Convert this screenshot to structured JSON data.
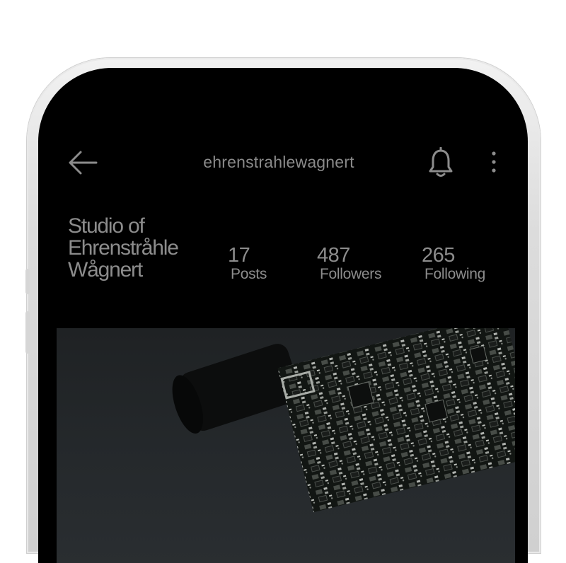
{
  "header": {
    "username": "ehrenstrahlewagnert"
  },
  "icons": {
    "back": "arrow-left-icon",
    "notifications": "bell-icon",
    "more": "more-vertical-icon"
  },
  "profile": {
    "display_name_lines": [
      "Studio of",
      "Ehrenstråhle",
      "Wågnert"
    ],
    "stats": {
      "posts": {
        "value": "17",
        "label": "Posts"
      },
      "followers": {
        "value": "487",
        "label": "Followers"
      },
      "following": {
        "value": "265",
        "label": "Following"
      }
    }
  },
  "colors": {
    "screen_background": "#000000",
    "text": "#8c8c8c",
    "frame": "#e2e2e2"
  }
}
